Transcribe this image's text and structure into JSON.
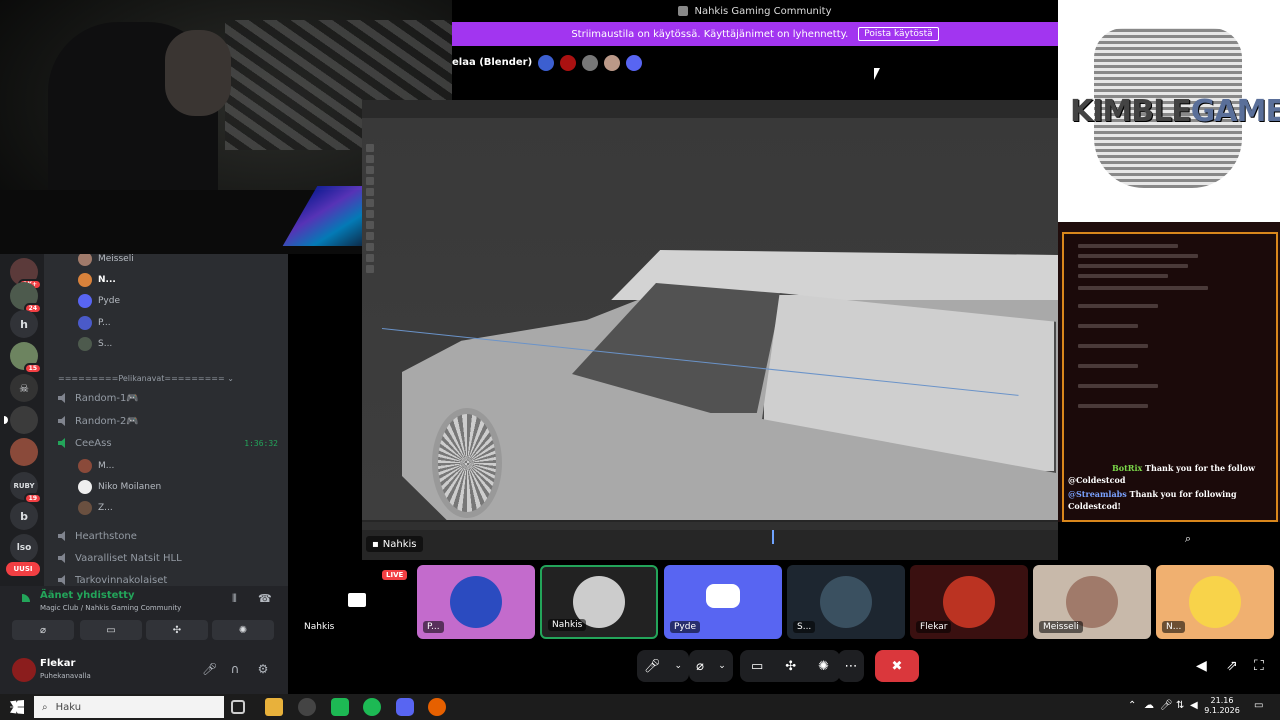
{
  "window": {
    "title": "Nahkis Gaming Community"
  },
  "notice": {
    "text": "Striimaustila on käytössä. Käyttäjänimet on lyhennetty.",
    "button": "Poista käytöstä"
  },
  "channel": {
    "title": "elaa (Blender)"
  },
  "logo": {
    "part1": "KIMBLE",
    "part2": "GAMES"
  },
  "chat": [
    {
      "user": "BotRix",
      "message": "Thank you for the follow @Coldestcod"
    },
    {
      "user": "@Streamlabs",
      "message": "Thank you for following Coldestcod!"
    }
  ],
  "stream": {
    "name_tag": "Nahkis"
  },
  "servers": [
    {
      "label": "",
      "badge": "1K+"
    },
    {
      "label": "",
      "badge": "24"
    },
    {
      "label": "h",
      "badge": ""
    },
    {
      "label": "",
      "badge": "15"
    },
    {
      "label": "",
      "badge": ""
    },
    {
      "label": "",
      "badge": ""
    },
    {
      "label": "",
      "badge": ""
    },
    {
      "label": "RUBY",
      "badge": "19"
    },
    {
      "label": "b",
      "badge": ""
    },
    {
      "label": "lso",
      "badge": ""
    }
  ],
  "uusi": "UUSI",
  "top_users": [
    "Meisseli",
    "N...",
    "Pyde",
    "P...",
    "S..."
  ],
  "category": "=========Pelikanavat========= ⌄",
  "voice_channels": [
    {
      "name": "Random-1🎮",
      "time": ""
    },
    {
      "name": "Random-2🎮",
      "time": ""
    },
    {
      "name": "CeeAss",
      "time": "1:36:32"
    }
  ],
  "ceeass_users": [
    "M...",
    "Niko Moilanen",
    "Z..."
  ],
  "more_channels": [
    "Hearthstone",
    "Vaaralliset Natsit HLL",
    "Tarkovinnakolaiset"
  ],
  "voice": {
    "status": "Äänet yhdistetty",
    "location": "Magic Club / Nahkis Gaming Community"
  },
  "user": {
    "name": "Flekar",
    "status": "Puhekanavalla"
  },
  "tiles": [
    {
      "label": "Nahkis",
      "live": "LIVE"
    },
    {
      "label": "P..."
    },
    {
      "label": "Nahkis"
    },
    {
      "label": "Pyde"
    },
    {
      "label": "S..."
    },
    {
      "label": "Flekar"
    },
    {
      "label": "Meisseli"
    },
    {
      "label": "N..."
    }
  ],
  "taskbar": {
    "search": "Haku",
    "time": "21.16",
    "date": "9.1.2026"
  },
  "colors": {
    "accent": "#a235f0",
    "discord": "#5865f2",
    "hangup": "#da373c",
    "online": "#23a55a"
  }
}
